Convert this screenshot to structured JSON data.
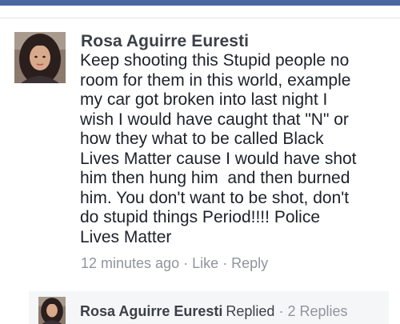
{
  "comment": {
    "author": "Rosa Aguirre Euresti",
    "avatar_icon": "profile-photo",
    "text_lines": [
      "Keep shooting this Stupid people no",
      "room for them in this world, example",
      "my car got broken into last night I",
      "wish I would have caught that \"N\" or",
      "how they what to be called Black",
      "Lives Matter cause I would have shot",
      "him then hung him  and then burned",
      "him. You don't want to be shot, don't",
      "do stupid things Period!!!! Police",
      "Lives Matter"
    ],
    "timestamp": "12 minutes ago",
    "like_label": "Like",
    "reply_label": "Reply",
    "separator": "·"
  },
  "reply_summary": {
    "author": "Rosa Aguirre Euresti",
    "action": "Replied",
    "separator": "·",
    "count_label": "2 Replies",
    "avatar_icon": "profile-photo"
  },
  "colors": {
    "header_bar": "#4b67a1",
    "author_text": "#3b3f47",
    "body_text": "#1d2129",
    "meta_text": "#90949c",
    "reply_panel_bg": "#f5f6f8"
  }
}
